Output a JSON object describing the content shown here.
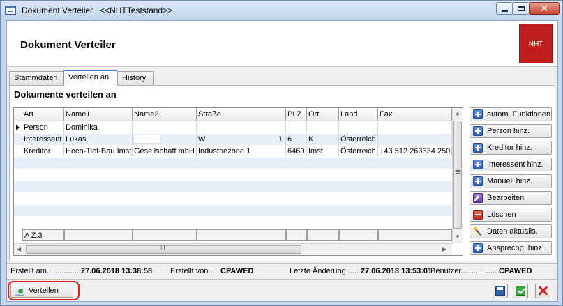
{
  "window": {
    "title": "Dokument Verteiler",
    "subtitle": "<<NHTTeststand>>"
  },
  "header": {
    "title": "Dokument Verteiler",
    "logo_text": "NHT"
  },
  "tabs": [
    {
      "label": "Stammdaten",
      "active": false
    },
    {
      "label": "Verteilen an",
      "active": true
    },
    {
      "label": "History",
      "active": false
    }
  ],
  "section": {
    "title": "Dokumente verteilen an"
  },
  "grid": {
    "columns": [
      "Art",
      "Name1",
      "Name2",
      "Straße",
      "PLZ",
      "Ort",
      "Land",
      "Fax"
    ],
    "rows": [
      {
        "art": "Person",
        "name1": "Dominika",
        "name2": "",
        "strasse": "",
        "hausnr": "",
        "plz": "",
        "ort": "",
        "land": "",
        "fax": ""
      },
      {
        "art": "Interessent",
        "name1": "Lukas",
        "name2": "",
        "strasse": "W",
        "hausnr": "1",
        "plz": "6",
        "ort": "K",
        "land": "Österreich",
        "fax": ""
      },
      {
        "art": "Kreditor",
        "name1": "Hoch-Tief-Bau Imst",
        "name2": "Gesellschaft mbH",
        "strasse": "Industriezone 1",
        "hausnr": "",
        "plz": "6460",
        "ort": "Imst",
        "land": "Österreich",
        "fax": "+43 512 263334 250"
      }
    ],
    "footer": "A Z:3",
    "hscroll_grip": "III"
  },
  "actions": [
    {
      "label": "autom. Funktionen",
      "icon": "plus-icon"
    },
    {
      "label": "Person hinz.",
      "icon": "plus-icon"
    },
    {
      "label": "Kreditor hinz.",
      "icon": "plus-icon"
    },
    {
      "label": "Interessent hinz.",
      "icon": "plus-icon"
    },
    {
      "label": "Manuell hinz.",
      "icon": "plus-icon"
    },
    {
      "label": "Bearbeiten",
      "icon": "edit-icon"
    },
    {
      "label": "Löschen",
      "icon": "minus-icon"
    },
    {
      "label": "Daten aktualis.",
      "icon": "wand-icon"
    },
    {
      "label": "Ansprechp. hinz.",
      "icon": "plus-icon"
    }
  ],
  "status": {
    "created_label": "Erstellt am.................",
    "created_value": "27.06.2018 13:38:58",
    "created_by_label": "Erstellt von...............",
    "created_by_value": "CPAWED",
    "changed_label": "Letzte Änderung......",
    "changed_value": "27.06.2018 13:53:01",
    "user_label": "Benutzer..................",
    "user_value": "CPAWED"
  },
  "bottom": {
    "verteilen_label": "Verteilen"
  }
}
